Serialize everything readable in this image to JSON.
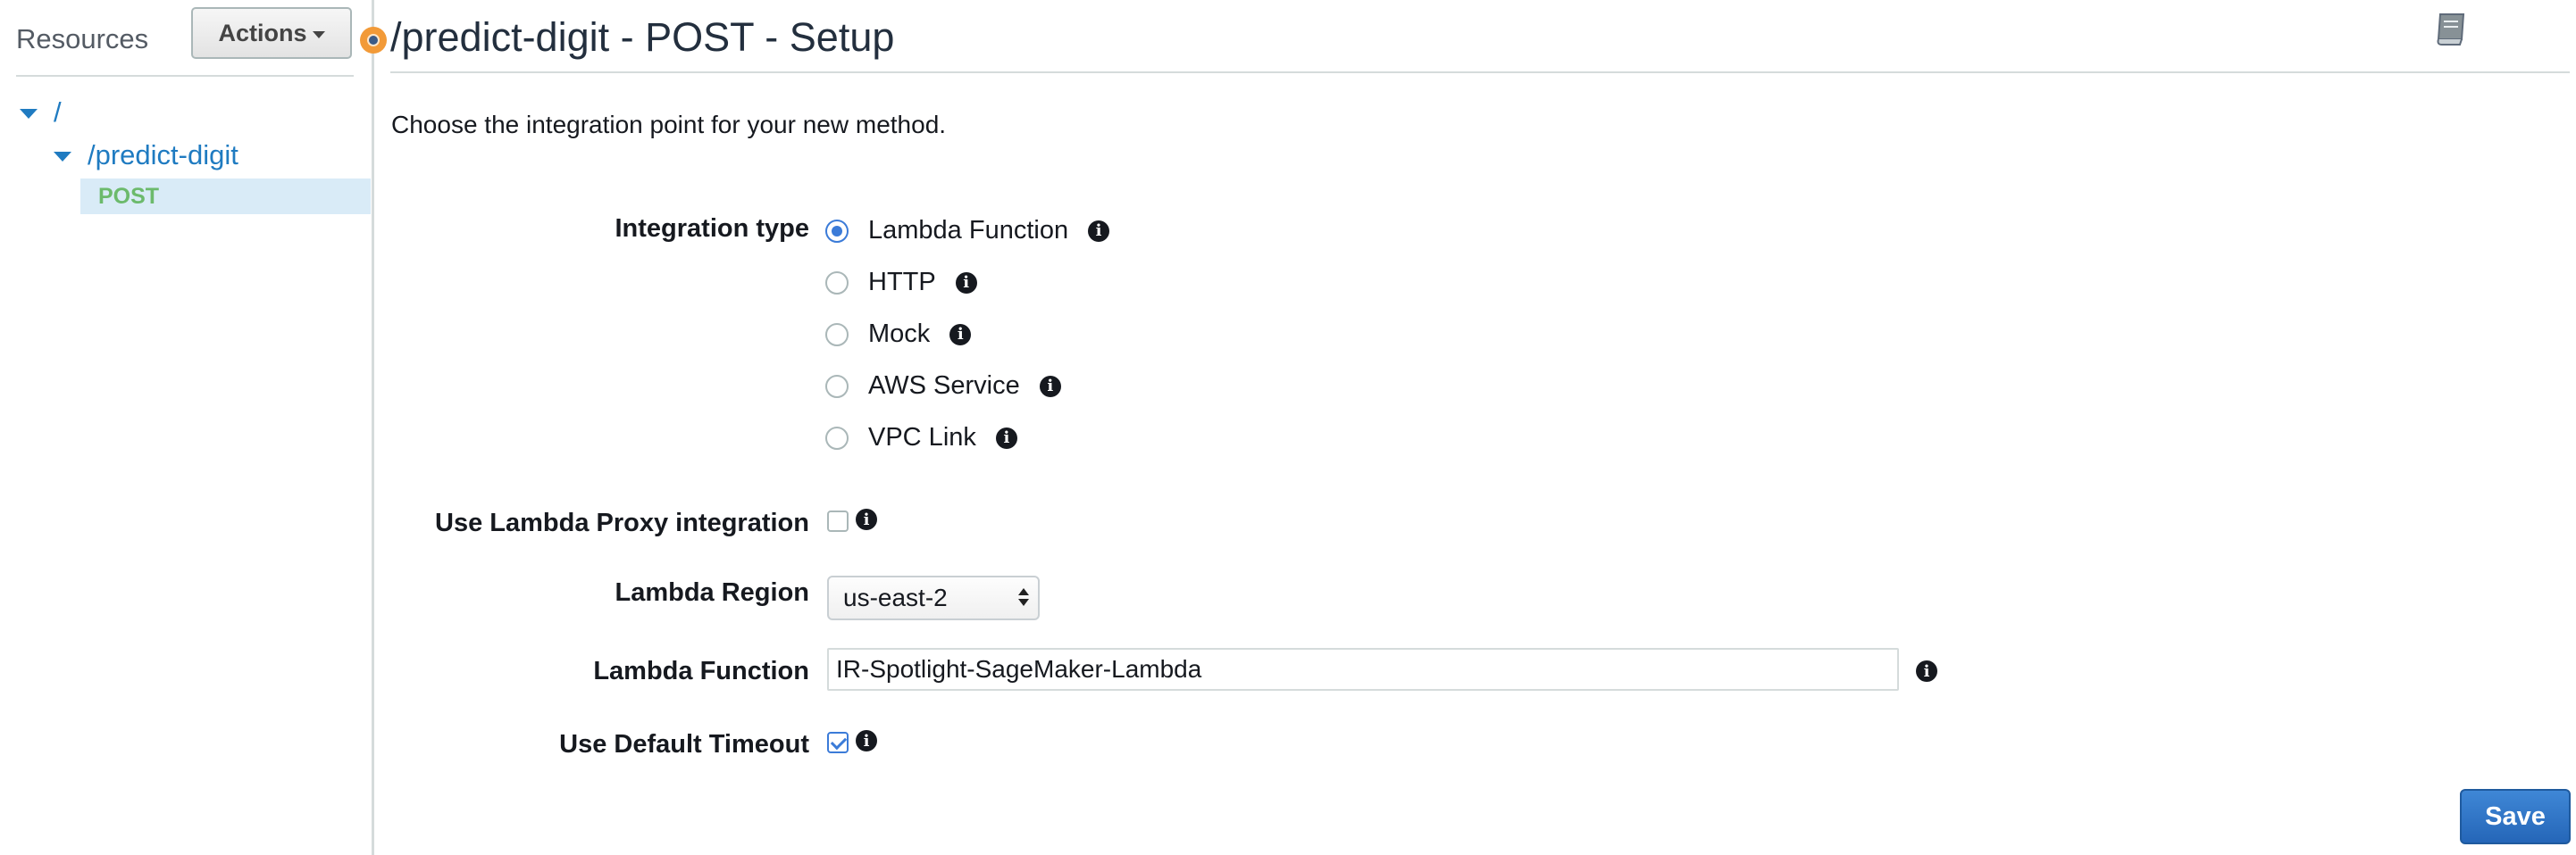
{
  "sidebar": {
    "title": "Resources",
    "actions_label": "Actions",
    "tree": {
      "root": "/",
      "resource": "/predict-digit",
      "method": "POST"
    }
  },
  "main": {
    "title": "/predict-digit - POST - Setup",
    "intro": "Choose the integration point for your new method.",
    "integration_type": {
      "label": "Integration type",
      "options": [
        "Lambda Function",
        "HTTP",
        "Mock",
        "AWS Service",
        "VPC Link"
      ],
      "selected": "Lambda Function"
    },
    "proxy": {
      "label": "Use Lambda Proxy integration",
      "checked": false
    },
    "region": {
      "label": "Lambda Region",
      "value": "us-east-2"
    },
    "function": {
      "label": "Lambda Function",
      "value": "IR-Spotlight-SageMaker-Lambda"
    },
    "timeout": {
      "label": "Use Default Timeout",
      "checked": true
    },
    "save_label": "Save"
  },
  "icons": {
    "info": "i",
    "help_book": "book-icon",
    "indicator": "orange-indicator"
  },
  "colors": {
    "link": "#1f7bc1",
    "method_green": "#6cba6c",
    "selected_row": "#d9ebf7",
    "primary_button": "#2e73c6",
    "indicator": "#f29a38"
  }
}
